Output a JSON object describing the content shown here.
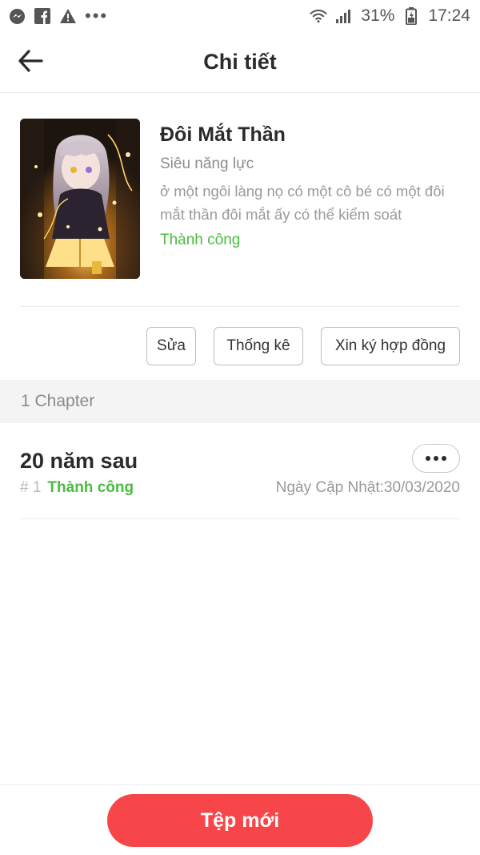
{
  "status_bar": {
    "battery_percent": "31%",
    "time": "17:24",
    "more_label": "•••",
    "icons": [
      "messenger-icon",
      "facebook-icon",
      "warning-icon",
      "wifi-icon",
      "signal-icon",
      "battery-icon"
    ]
  },
  "header": {
    "title": "Chi tiết",
    "back_icon": "arrow-left-icon"
  },
  "book": {
    "title": "Đôi Mắt Thần",
    "genre": "Siêu năng lực",
    "description": "ở một ngôi làng nọ có một cô bé có một đôi mắt thần đôi mắt ấy có thể kiểm soát",
    "status": "Thành công",
    "cover_icon": "book-cover-image"
  },
  "actions": {
    "edit_label": "Sửa",
    "stats_label": "Thống kê",
    "contract_label": "Xin ký hợp đồng"
  },
  "chapters": {
    "count_label": "1 Chapter",
    "items": [
      {
        "name": "20 năm sau",
        "number": "# 1",
        "status": "Thành công",
        "updated": "Ngày Cập Nhật:30/03/2020"
      }
    ]
  },
  "footer": {
    "new_file_label": "Tệp mới"
  },
  "colors": {
    "accent": "#f6464a",
    "success": "#4cbb3f",
    "divider": "#ececec",
    "band": "#f4f4f4"
  }
}
